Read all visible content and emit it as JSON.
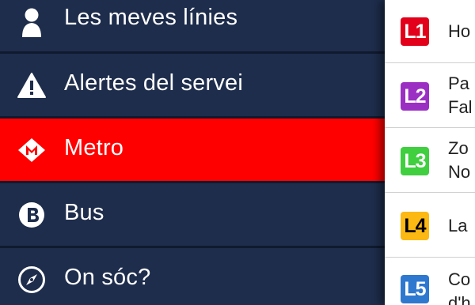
{
  "menu": {
    "items": [
      {
        "label": "Les meves línies",
        "icon": "person-icon",
        "active": false
      },
      {
        "label": "Alertes del servei",
        "icon": "warning-icon",
        "active": false
      },
      {
        "label": "Metro",
        "icon": "metro-logo-icon",
        "active": true
      },
      {
        "label": "Bus",
        "icon": "bus-logo-icon",
        "active": false
      },
      {
        "label": "On sóc?",
        "icon": "compass-icon",
        "active": false
      }
    ]
  },
  "lines": [
    {
      "code": "L1",
      "name_line1": "Ho",
      "name_line2": "",
      "color": "#e2001a",
      "text_color": "#ffffff"
    },
    {
      "code": "L2",
      "name_line1": "Pa",
      "name_line2": "Fal",
      "color": "#9b2fc4",
      "text_color": "#ffffff"
    },
    {
      "code": "L3",
      "name_line1": "Zo",
      "name_line2": "No",
      "color": "#3fcf3f",
      "text_color": "#ffffff"
    },
    {
      "code": "L4",
      "name_line1": "La",
      "name_line2": "",
      "color": "#fcb813",
      "text_color": "#000000"
    },
    {
      "code": "L5",
      "name_line1": "Co",
      "name_line2": "d'h",
      "color": "#2f78cf",
      "text_color": "#ffffff"
    }
  ],
  "colors": {
    "menu_background": "#1e2d4c",
    "active_background": "#ff0000",
    "panel_background": "#ffffff"
  }
}
